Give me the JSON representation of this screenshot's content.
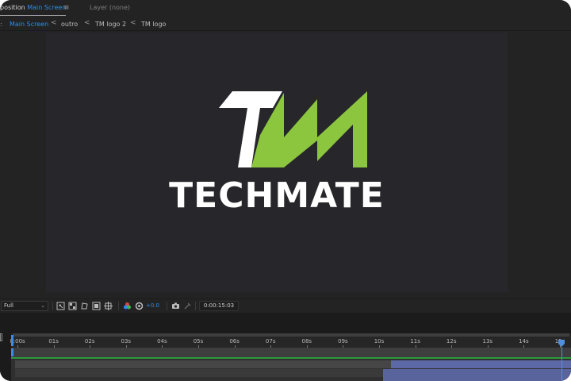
{
  "tabs": {
    "composition_prefix": "position",
    "composition_name": "Main Screen",
    "menu_glyph": "≡",
    "layer_label": "Layer (none)"
  },
  "breadcrumb": {
    "items": [
      "Main Screen",
      "outro",
      "TM logo 2",
      "TM logo"
    ],
    "separator": "<"
  },
  "viewer": {
    "brand_word": "TECHMATE",
    "logo_colors": {
      "white": "#ffffff",
      "green": "#8cc63f"
    }
  },
  "controls": {
    "resolution": "Full",
    "exposure": "+0.0",
    "timecode": "0:00:15:03",
    "icons": [
      "region-of-interest-icon",
      "transparency-grid-icon",
      "mask-path-icon",
      "safe-margins-icon",
      "grid-guides-icon",
      "channel-icon",
      "color-management-icon",
      "snapshot-icon",
      "show-snapshot-icon"
    ]
  },
  "timeline": {
    "ticks": [
      "0:00s",
      "01s",
      "02s",
      "03s",
      "04s",
      "05s",
      "06s",
      "07s",
      "08s",
      "09s",
      "10s",
      "11s",
      "12s",
      "13s",
      "14s",
      "15s"
    ],
    "current_time_fraction": 0.997
  },
  "colors": {
    "accent": "#2d8ceb",
    "panel_bg": "#232323",
    "canvas_bg": "#27272b",
    "track_green": "#2c9a3a",
    "layer_bar": "#5d68a6"
  }
}
